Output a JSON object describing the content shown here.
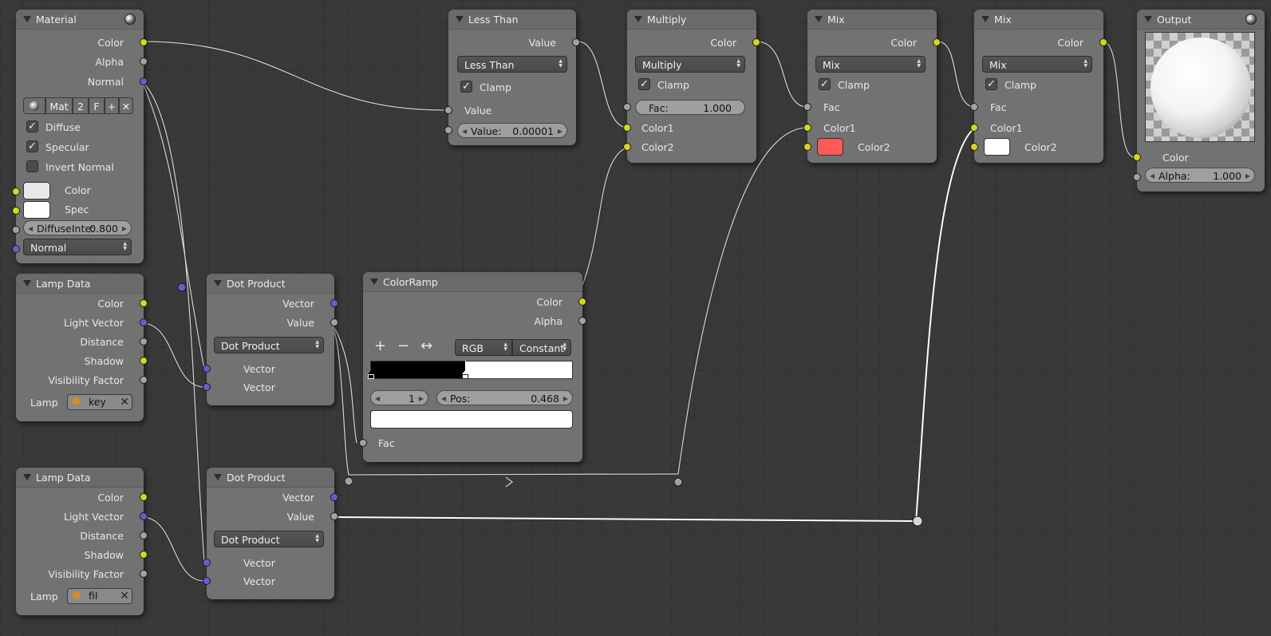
{
  "nodes": {
    "material": {
      "title": "Material",
      "outputs": [
        "Color",
        "Alpha",
        "Normal"
      ],
      "toolbar": {
        "mat": "Mat",
        "users": "2",
        "fake": "F",
        "add": "+",
        "close": "✕"
      },
      "checks": [
        {
          "label": "Diffuse",
          "checked": true
        },
        {
          "label": "Specular",
          "checked": true
        },
        {
          "label": "Invert Normal",
          "checked": false
        }
      ],
      "inputs": {
        "color_label": "Color",
        "color_value": "#e8e8e8",
        "spec_label": "Spec",
        "spec_value": "#ffffff",
        "diffuse_label": "DiffuseInte:",
        "diffuse_value": "0.800",
        "normal_label": "Normal"
      }
    },
    "lamp1": {
      "title": "Lamp Data",
      "outputs": [
        "Color",
        "Light Vector",
        "Distance",
        "Shadow",
        "Visibility Factor"
      ],
      "lamp_label": "Lamp",
      "lamp_name": "key"
    },
    "lamp2": {
      "title": "Lamp Data",
      "outputs": [
        "Color",
        "Light Vector",
        "Distance",
        "Shadow",
        "Visibility Factor"
      ],
      "lamp_label": "Lamp",
      "lamp_name": "fil"
    },
    "dot1": {
      "title": "Dot Product",
      "outputs": [
        "Vector",
        "Value"
      ],
      "operation": "Dot Product",
      "inputs": [
        "Vector",
        "Vector"
      ]
    },
    "dot2": {
      "title": "Dot Product",
      "outputs": [
        "Vector",
        "Value"
      ],
      "operation": "Dot Product",
      "inputs": [
        "Vector",
        "Vector"
      ]
    },
    "less_than": {
      "title": "Less Than",
      "output": "Value",
      "operation": "Less Than",
      "clamp_label": "Clamp",
      "clamp": true,
      "input1": "Value",
      "input2_label": "Value:",
      "input2_value": "0.00001"
    },
    "multiply": {
      "title": "Multiply",
      "output": "Color",
      "operation": "Multiply",
      "clamp_label": "Clamp",
      "clamp": true,
      "fac_label": "Fac:",
      "fac_value": "1.000",
      "inputs": [
        "Color1",
        "Color2"
      ]
    },
    "mix1": {
      "title": "Mix",
      "output": "Color",
      "operation": "Mix",
      "clamp_label": "Clamp",
      "clamp": true,
      "inputs": [
        "Fac",
        "Color1",
        "Color2"
      ],
      "color2_value": "#ff5a5a"
    },
    "mix2": {
      "title": "Mix",
      "output": "Color",
      "operation": "Mix",
      "clamp_label": "Clamp",
      "clamp": true,
      "inputs": [
        "Fac",
        "Color1",
        "Color2"
      ],
      "color2_value": "#ffffff"
    },
    "output": {
      "title": "Output",
      "input_color": "Color",
      "alpha_label": "Alpha:",
      "alpha_value": "1.000"
    },
    "colorramp": {
      "title": "ColorRamp",
      "outputs": [
        "Color",
        "Alpha"
      ],
      "tools": {
        "add": "+",
        "remove": "−",
        "flip": "↔"
      },
      "color_mode": "RGB",
      "interpolation": "Constant",
      "stop_index": "1",
      "pos_label": "Pos:",
      "pos_value": "0.468",
      "input": "Fac"
    }
  },
  "colors": {
    "socket_color": "#d6d51f",
    "socket_value": "#a2a2a2",
    "socket_vector": "#6060d0"
  }
}
